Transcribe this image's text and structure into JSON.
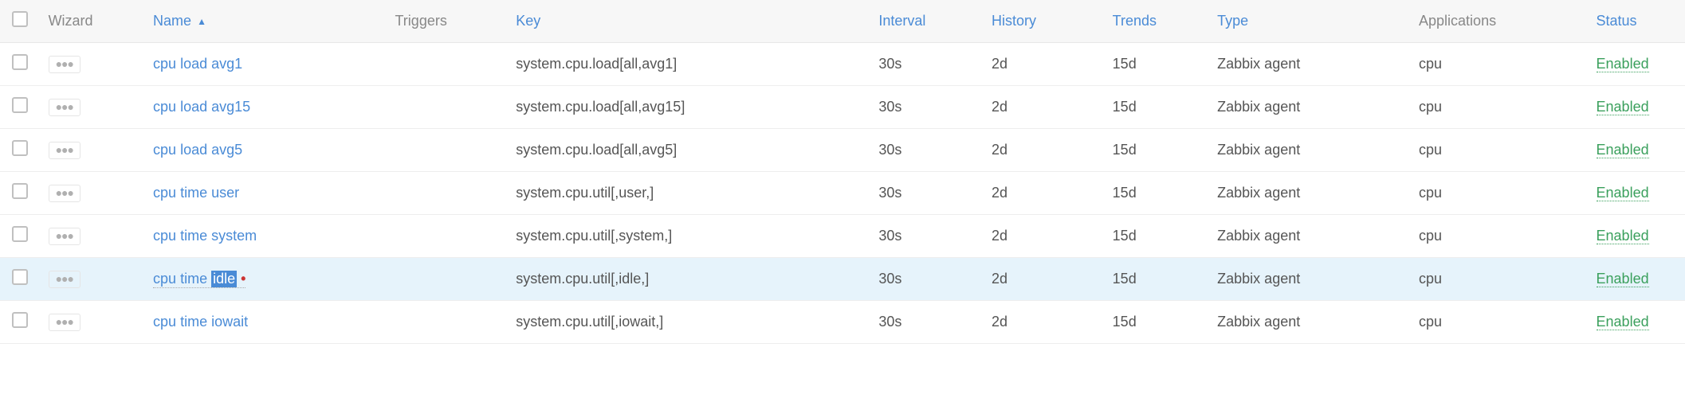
{
  "columns": {
    "wizard": "Wizard",
    "name": "Name",
    "triggers": "Triggers",
    "key": "Key",
    "interval": "Interval",
    "history": "History",
    "trends": "Trends",
    "type": "Type",
    "applications": "Applications",
    "status": "Status"
  },
  "sort": {
    "column": "name",
    "direction": "asc",
    "arrow": "▲"
  },
  "rows": [
    {
      "name": "cpu load avg1",
      "triggers": "",
      "key": "system.cpu.load[all,avg1]",
      "interval": "30s",
      "history": "2d",
      "trends": "15d",
      "type": "Zabbix agent",
      "applications": "cpu",
      "status": "Enabled",
      "active": false
    },
    {
      "name": "cpu load avg15",
      "triggers": "",
      "key": "system.cpu.load[all,avg15]",
      "interval": "30s",
      "history": "2d",
      "trends": "15d",
      "type": "Zabbix agent",
      "applications": "cpu",
      "status": "Enabled",
      "active": false
    },
    {
      "name": "cpu load avg5",
      "triggers": "",
      "key": "system.cpu.load[all,avg5]",
      "interval": "30s",
      "history": "2d",
      "trends": "15d",
      "type": "Zabbix agent",
      "applications": "cpu",
      "status": "Enabled",
      "active": false
    },
    {
      "name": "cpu time user",
      "triggers": "",
      "key": "system.cpu.util[,user,]",
      "interval": "30s",
      "history": "2d",
      "trends": "15d",
      "type": "Zabbix agent",
      "applications": "cpu",
      "status": "Enabled",
      "active": false
    },
    {
      "name": "cpu time system",
      "triggers": "",
      "key": "system.cpu.util[,system,]",
      "interval": "30s",
      "history": "2d",
      "trends": "15d",
      "type": "Zabbix agent",
      "applications": "cpu",
      "status": "Enabled",
      "active": false
    },
    {
      "name_prefix": "cpu time ",
      "name_selected": "idle",
      "name_cursor_mark": "•",
      "triggers": "",
      "key": "system.cpu.util[,idle,]",
      "interval": "30s",
      "history": "2d",
      "trends": "15d",
      "type": "Zabbix agent",
      "applications": "cpu",
      "status": "Enabled",
      "active": true
    },
    {
      "name": "cpu time iowait",
      "triggers": "",
      "key": "system.cpu.util[,iowait,]",
      "interval": "30s",
      "history": "2d",
      "trends": "15d",
      "type": "Zabbix agent",
      "applications": "cpu",
      "status": "Enabled",
      "active": false
    }
  ]
}
